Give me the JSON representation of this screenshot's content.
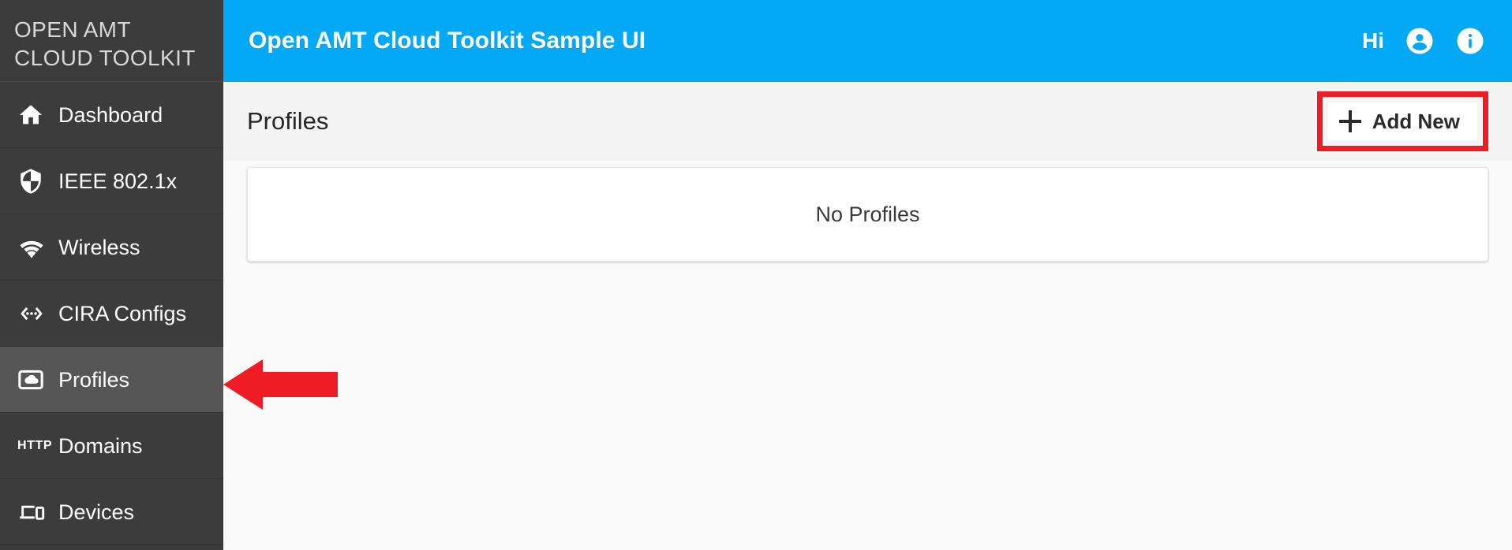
{
  "sidebar": {
    "brand": {
      "line1": "OPEN AMT",
      "line2": "CLOUD TOOLKIT"
    },
    "items": [
      {
        "label": "Dashboard",
        "icon": "home-icon",
        "active": false
      },
      {
        "label": "IEEE 802.1x",
        "icon": "shield-icon",
        "active": false
      },
      {
        "label": "Wireless",
        "icon": "wifi-icon",
        "active": false
      },
      {
        "label": "CIRA Configs",
        "icon": "code-icon",
        "active": false
      },
      {
        "label": "Profiles",
        "icon": "cloud-frame-icon",
        "active": true
      },
      {
        "label": "Domains",
        "icon": "http-icon",
        "active": false
      },
      {
        "label": "Devices",
        "icon": "devices-icon",
        "active": false
      }
    ]
  },
  "header": {
    "title": "Open AMT Cloud Toolkit Sample UI",
    "greeting": "Hi",
    "account_icon": "account-circle-icon",
    "info_icon": "info-icon",
    "background_color": "#03a9f4"
  },
  "toolbar": {
    "page_title": "Profiles",
    "add_new_label": "Add New",
    "add_new_icon": "plus-icon",
    "highlight_color": "#ee1c25"
  },
  "content": {
    "empty_message": "No Profiles"
  },
  "annotations": {
    "arrow": {
      "shape": "left-arrow",
      "color": "#ee1c25",
      "points_to": "sidebar-item-profiles"
    }
  }
}
